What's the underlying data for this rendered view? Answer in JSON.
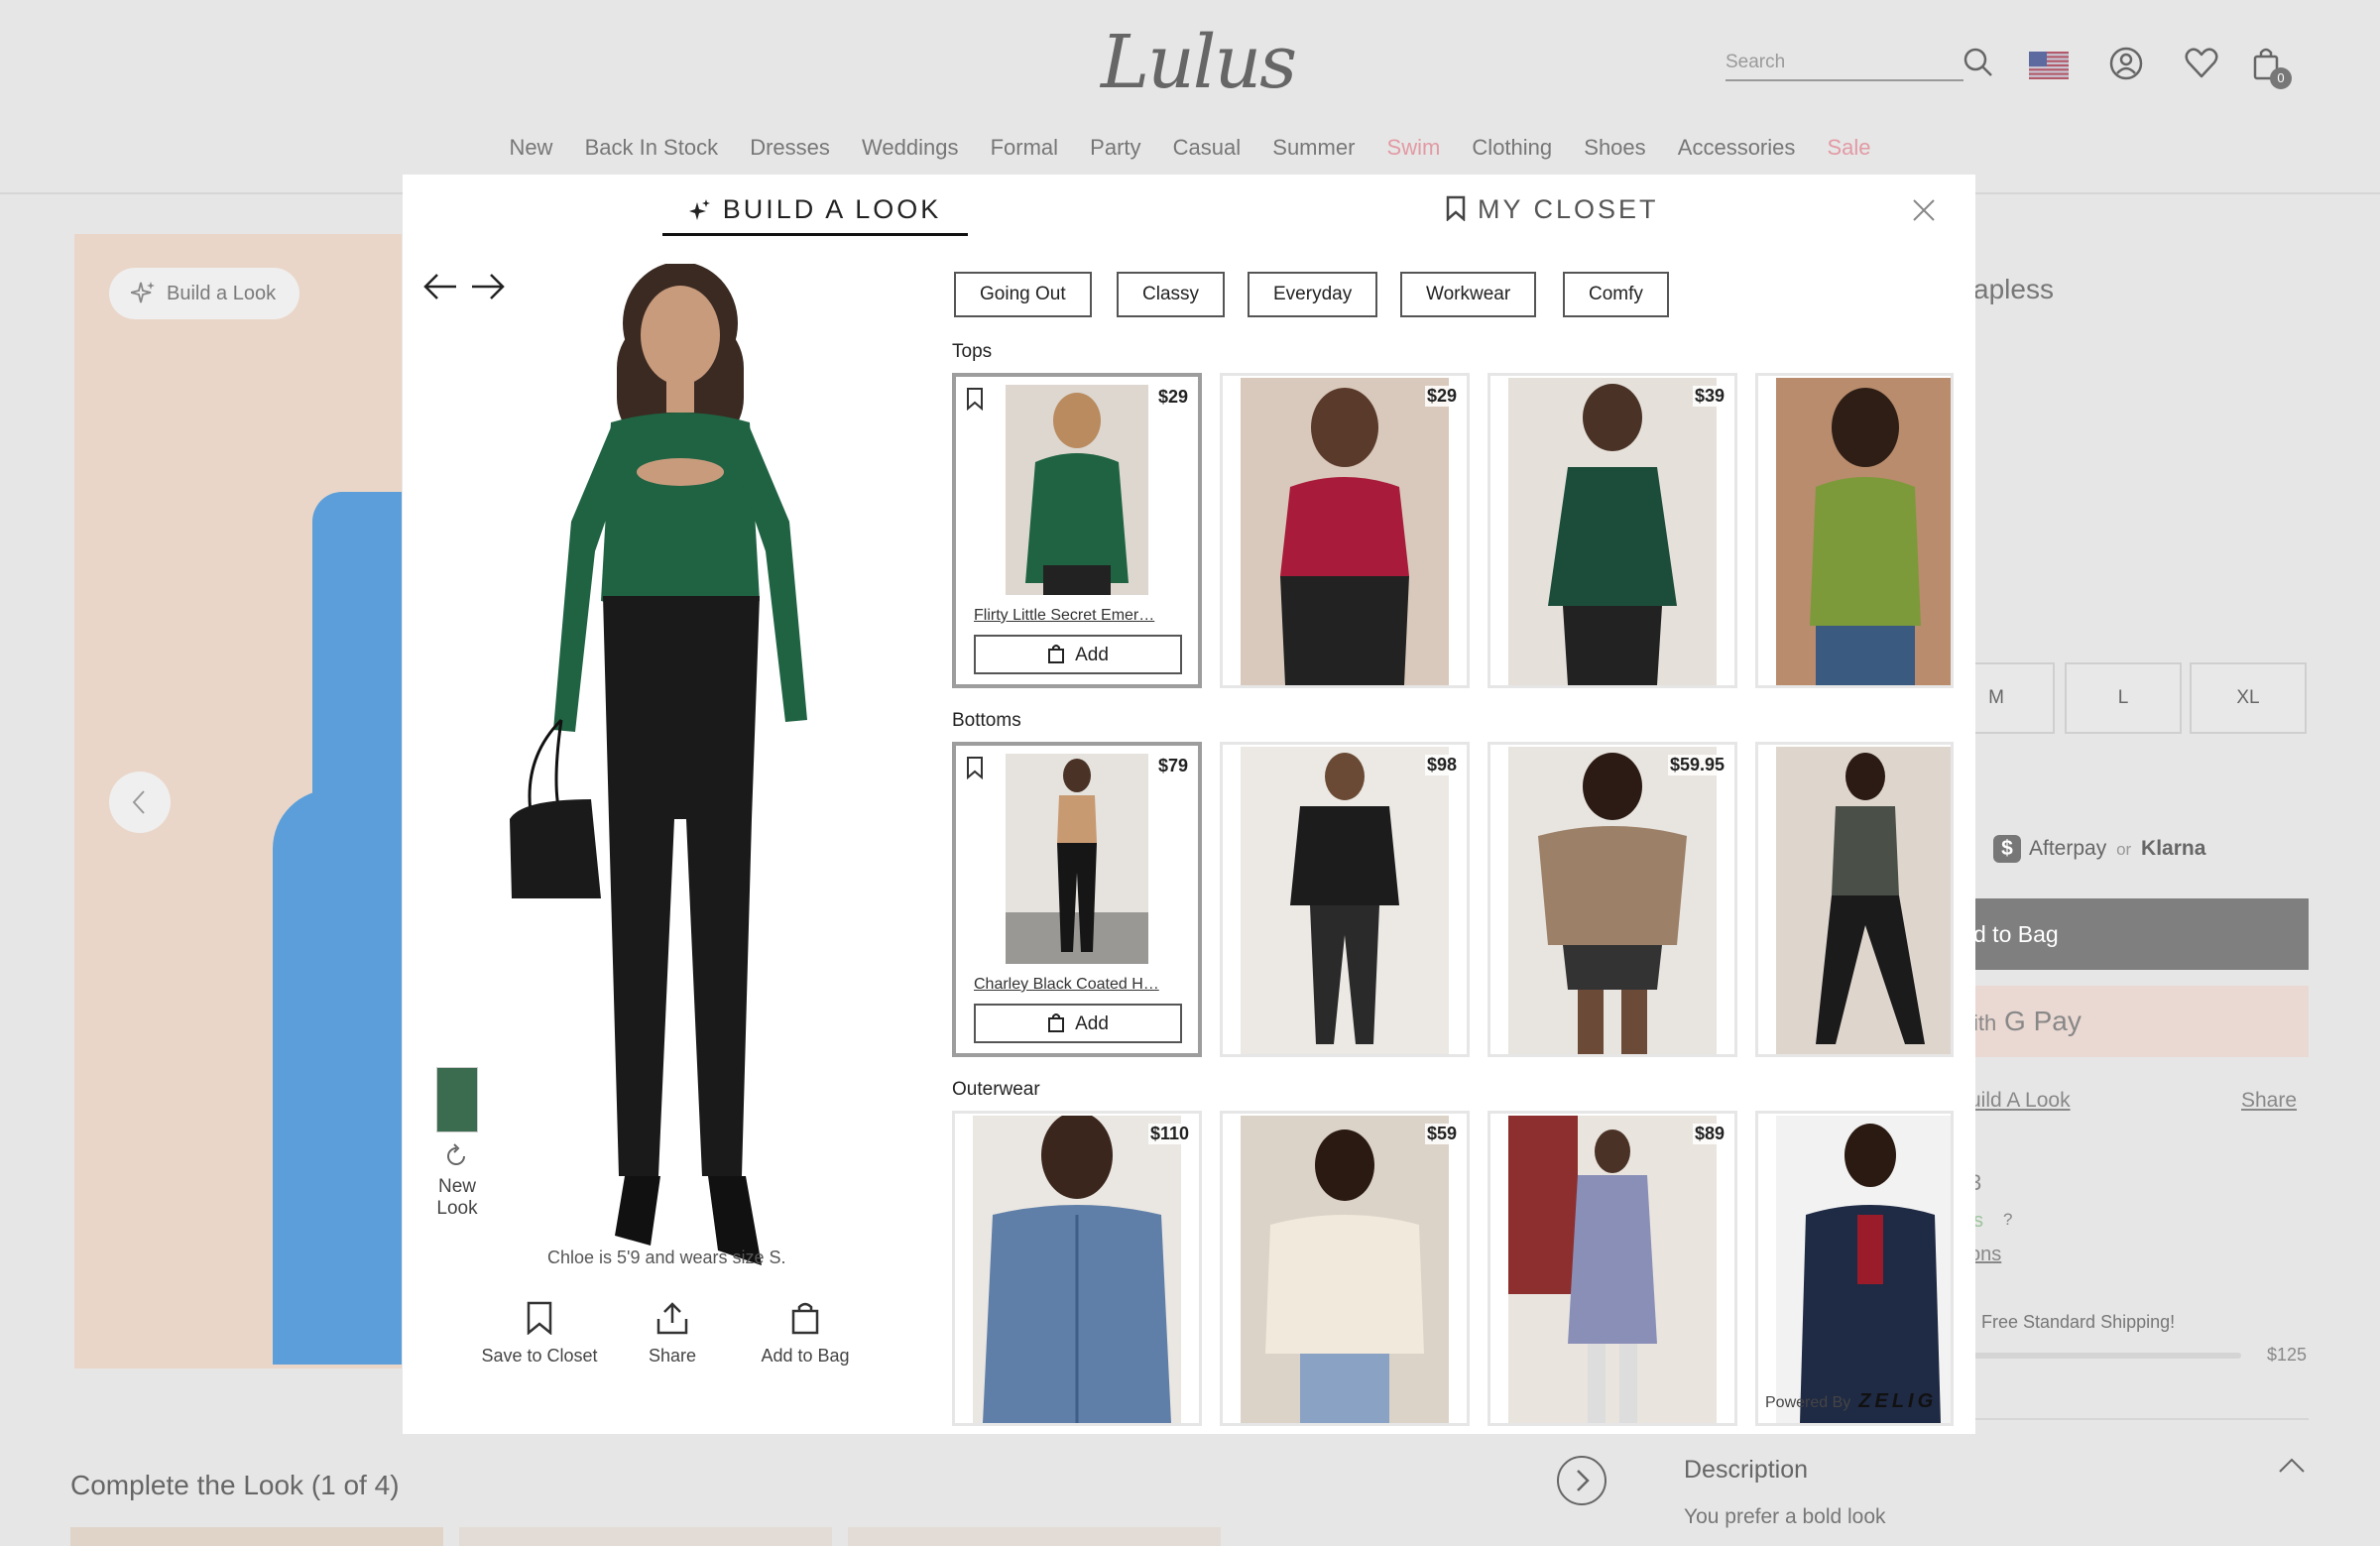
{
  "header": {
    "logo": "Lulus",
    "search_placeholder": "Search",
    "bag_count": "0",
    "nav": [
      {
        "label": "New",
        "highlight": false
      },
      {
        "label": "Back In Stock",
        "highlight": false
      },
      {
        "label": "Dresses",
        "highlight": false
      },
      {
        "label": "Weddings",
        "highlight": false
      },
      {
        "label": "Formal",
        "highlight": false
      },
      {
        "label": "Party",
        "highlight": false
      },
      {
        "label": "Casual",
        "highlight": false
      },
      {
        "label": "Summer",
        "highlight": false
      },
      {
        "label": "Swim",
        "highlight": true
      },
      {
        "label": "Clothing",
        "highlight": false
      },
      {
        "label": "Shoes",
        "highlight": false
      },
      {
        "label": "Accessories",
        "highlight": false
      },
      {
        "label": "Sale",
        "highlight": true
      }
    ]
  },
  "background": {
    "build_a_look_pill": "Build a Look",
    "complete_the_look": "Complete the Look (1 of 4)",
    "product_title_fragment": "apless",
    "sizes": [
      "M",
      "L",
      "XL"
    ],
    "afterpay": "Afterpay",
    "or": "or",
    "klarna": "Klarna",
    "add_to_bag": "d to Bag",
    "gpay_prefix": "ith",
    "gpay": "G Pay",
    "build_look_link": "uild A Look",
    "share_link": "Share",
    "rewards_digit": "3",
    "rewards_s": "s",
    "rewards_q": "?",
    "options_fragment": "ons",
    "free_shipping": "Free Standard Shipping!",
    "shipping_amount": "$125",
    "description_title": "Description",
    "description_text": "You prefer a bold look"
  },
  "modal": {
    "tab_build": "BUILD A LOOK",
    "tab_closet": "MY CLOSET",
    "filters": [
      "Going Out",
      "Classy",
      "Everyday",
      "Workwear",
      "Comfy"
    ],
    "model_note": "Chloe is 5'9 and wears size S.",
    "new_look": "New Look",
    "actions": {
      "save": "Save to Closet",
      "share": "Share",
      "add": "Add to Bag"
    },
    "powered_by": "Powered By",
    "powered_brand": "ZELIG",
    "sections": [
      {
        "label": "Tops",
        "items": [
          {
            "price": "$29",
            "name": "Flirty Little Secret Emer…",
            "add": "Add",
            "selected": true
          },
          {
            "price": "$29",
            "selected": false
          },
          {
            "price": "$39",
            "selected": false
          },
          {
            "price": "",
            "selected": false
          }
        ]
      },
      {
        "label": "Bottoms",
        "items": [
          {
            "price": "$79",
            "name": "Charley Black Coated H…",
            "add": "Add",
            "selected": true
          },
          {
            "price": "$98",
            "selected": false
          },
          {
            "price": "$59.95",
            "selected": false
          },
          {
            "price": "",
            "selected": false
          }
        ]
      },
      {
        "label": "Outerwear",
        "items": [
          {
            "price": "$110",
            "selected": false
          },
          {
            "price": "$59",
            "selected": false
          },
          {
            "price": "$89",
            "selected": false
          },
          {
            "price": "",
            "selected": false
          }
        ]
      }
    ]
  }
}
